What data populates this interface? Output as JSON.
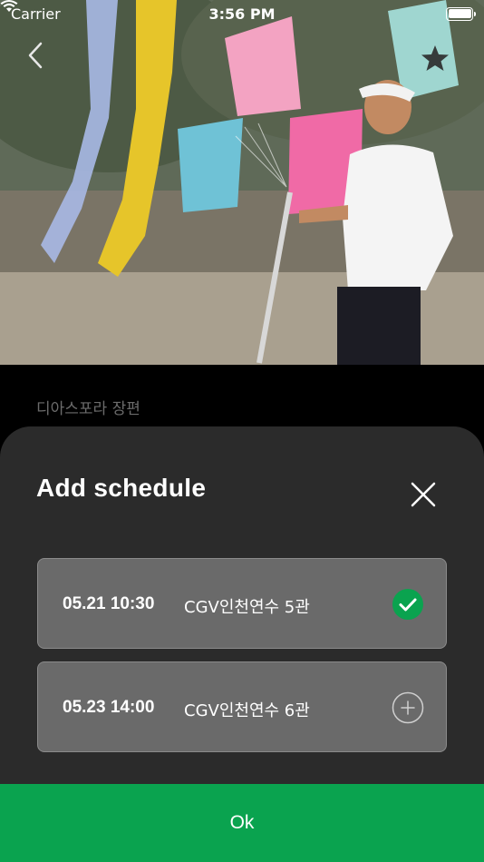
{
  "status_bar": {
    "carrier": "Carrier",
    "time": "3:56 PM"
  },
  "hero": {
    "image_icon": "movie-still-image"
  },
  "nav": {
    "back_icon": "chevron-left-icon",
    "favorite_icon": "star-icon"
  },
  "film": {
    "title": "디아스포라 장편"
  },
  "sheet": {
    "title": "Add schedule",
    "close_icon": "close-icon",
    "items": [
      {
        "datetime": "05.21 10:30",
        "place": "CGV인천연수 5관",
        "selected": true,
        "icon": "check-circle-icon"
      },
      {
        "datetime": "05.23 14:00",
        "place": "CGV인천연수 6관",
        "selected": false,
        "icon": "plus-circle-icon"
      }
    ]
  },
  "ok_button": {
    "label": "Ok"
  },
  "colors": {
    "accent": "#0aa34f",
    "sheet_bg": "#2b2b2b",
    "item_bg": "#6a6a6a"
  }
}
